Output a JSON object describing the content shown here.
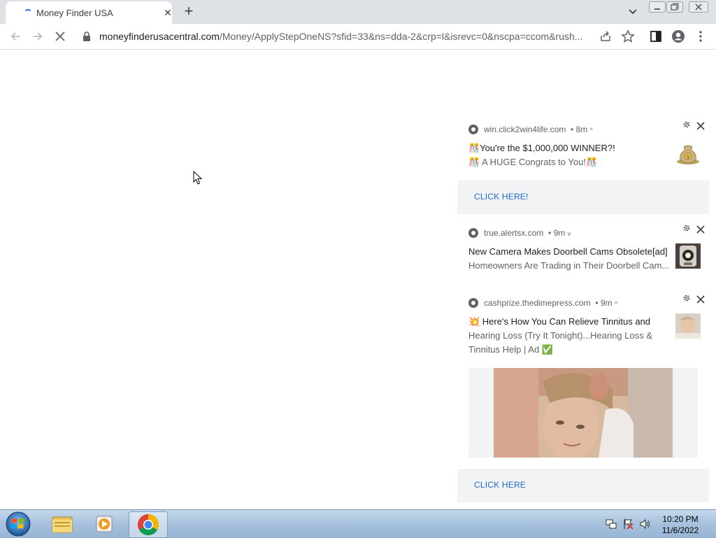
{
  "browser": {
    "tab_title": "Money Finder USA",
    "url_host": "moneyfinderusacentral.com",
    "url_path": "/Money/ApplyStepOneNS?sfid=33&ns=dda-2&crp=l&isrevc=0&nscpa=ccom&rush...",
    "tab_close": "✕",
    "new_tab": "+"
  },
  "notifications": [
    {
      "source": "win.click2win4life.com",
      "age": "8m",
      "chevron": "^",
      "title": "🎊You're the $1,000,000 WINNER?!",
      "body": "🎊 A HUGE Congrats to You!🎊",
      "action": "CLICK HERE!",
      "thumb_icon": "money-bag-icon"
    },
    {
      "source": "true.alertsx.com",
      "age": "9m",
      "chevron": "v",
      "title": "New Camera Makes Doorbell Cams Obsolete[ad]",
      "body": "Homeowners Are Trading in Their Doorbell Cam...",
      "thumb_icon": "camera-photo-icon"
    },
    {
      "source": "cashprize.thedimepress.com",
      "age": "9m",
      "chevron": "^",
      "title": "💥 Here's How You Can Relieve Tinnitus and",
      "body": "Hearing Loss (Try It Tonight)...Hearing Loss & Tinnitus Help | Ad ✅",
      "action": "CLICK HERE",
      "thumb_icon": "woman-photo-icon"
    }
  ],
  "taskbar": {
    "time": "10:20 PM",
    "date": "11/6/2022"
  },
  "colors": {
    "tabstrip": "#dee1e6",
    "link": "#1967d2",
    "action_bg": "#f1f3f4",
    "taskbar": "#a9c3de"
  }
}
